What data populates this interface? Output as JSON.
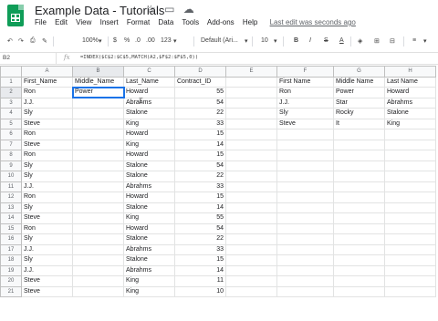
{
  "title": "Example Data - Tutorials",
  "title_icons": [
    "star-icon",
    "folder-icon",
    "cloud-icon"
  ],
  "menu": [
    "File",
    "Edit",
    "View",
    "Insert",
    "Format",
    "Data",
    "Tools",
    "Add-ons",
    "Help"
  ],
  "last_edit": "Last edit was seconds ago",
  "toolbar": {
    "zoom": "100%",
    "currency": "$",
    "percent": "%",
    "decimal_less": ".0",
    "decimal_more": ".00",
    "more_formats": "123",
    "font": "Default (Ari...",
    "font_size": "10",
    "bold": "B",
    "italic": "I",
    "strike": "S",
    "text_color": "A"
  },
  "name_box": "B2",
  "formula": "=INDEX($C$2:$C$5,MATCH(A2,$F$2:$F$5,0))",
  "columns": [
    "A",
    "B",
    "C",
    "D",
    "E",
    "F",
    "G",
    "H"
  ],
  "row_numbers": [
    "1",
    "2",
    "3",
    "4",
    "5",
    "6",
    "7",
    "8",
    "9",
    "10",
    "11",
    "12",
    "13",
    "14",
    "15",
    "16",
    "17",
    "18",
    "19",
    "20",
    "21"
  ],
  "rows": [
    [
      "First_Name",
      "Middle_Name",
      "Last_Name",
      "Contract_ID",
      "",
      "First Name",
      "Middle Name",
      "Last Name"
    ],
    [
      "Ron",
      "Power",
      "Howard",
      "55",
      "",
      "Ron",
      "Power",
      "Howard"
    ],
    [
      "J.J.",
      "",
      "Abrahms",
      "54",
      "",
      "J.J.",
      "Star",
      "Abrahms"
    ],
    [
      "Sly",
      "",
      "Stalone",
      "22",
      "",
      "Sly",
      "Rocky",
      "Stalone"
    ],
    [
      "Steve",
      "",
      "King",
      "33",
      "",
      "Steve",
      "It",
      "King"
    ],
    [
      "Ron",
      "",
      "Howard",
      "15",
      "",
      "",
      "",
      ""
    ],
    [
      "Steve",
      "",
      "King",
      "14",
      "",
      "",
      "",
      ""
    ],
    [
      "Ron",
      "",
      "Howard",
      "15",
      "",
      "",
      "",
      ""
    ],
    [
      "Sly",
      "",
      "Stalone",
      "54",
      "",
      "",
      "",
      ""
    ],
    [
      "Sly",
      "",
      "Stalone",
      "22",
      "",
      "",
      "",
      ""
    ],
    [
      "J.J.",
      "",
      "Abrahms",
      "33",
      "",
      "",
      "",
      ""
    ],
    [
      "Ron",
      "",
      "Howard",
      "15",
      "",
      "",
      "",
      ""
    ],
    [
      "Sly",
      "",
      "Stalone",
      "14",
      "",
      "",
      "",
      ""
    ],
    [
      "Steve",
      "",
      "King",
      "55",
      "",
      "",
      "",
      ""
    ],
    [
      "Ron",
      "",
      "Howard",
      "54",
      "",
      "",
      "",
      ""
    ],
    [
      "Sly",
      "",
      "Stalone",
      "22",
      "",
      "",
      "",
      ""
    ],
    [
      "J.J.",
      "",
      "Abrahms",
      "33",
      "",
      "",
      "",
      ""
    ],
    [
      "Sly",
      "",
      "Stalone",
      "15",
      "",
      "",
      "",
      ""
    ],
    [
      "J.J.",
      "",
      "Abrahms",
      "14",
      "",
      "",
      "",
      ""
    ],
    [
      "Steve",
      "",
      "King",
      "11",
      "",
      "",
      "",
      ""
    ],
    [
      "Steve",
      "",
      "King",
      "10",
      "",
      "",
      "",
      ""
    ]
  ],
  "active_cell": "B2",
  "colors": {
    "brand": "#0f9d58",
    "accent": "#1a73e8"
  }
}
